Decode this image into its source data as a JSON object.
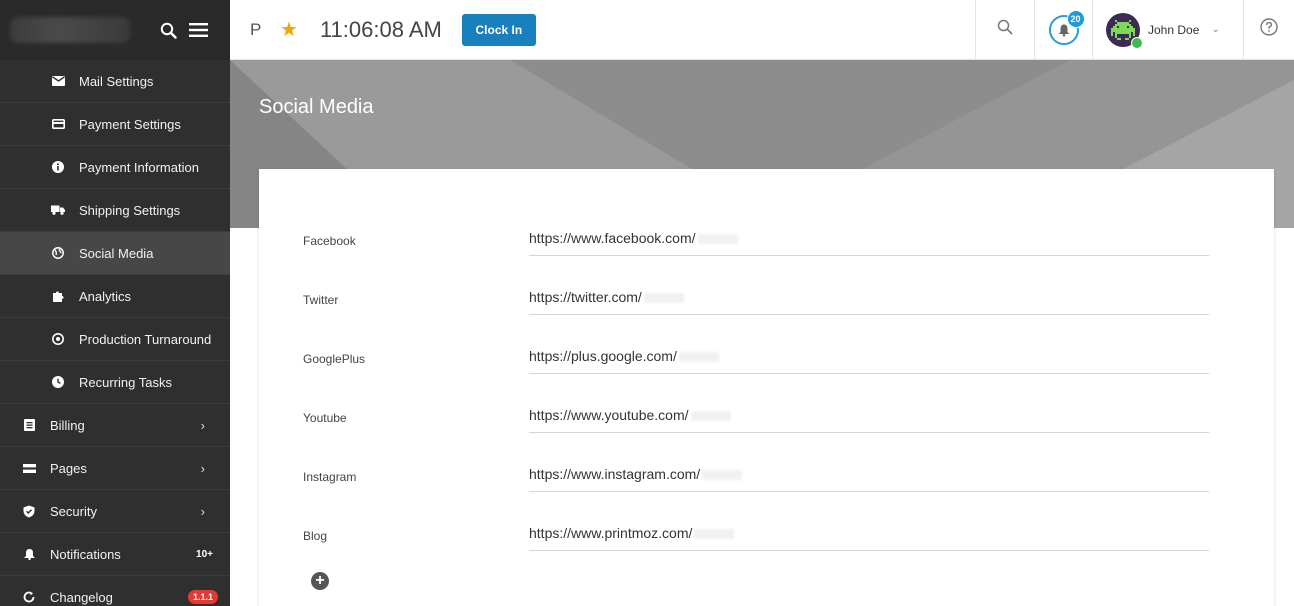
{
  "header": {
    "p_label": "P",
    "time": "11:06:08 AM",
    "clock_in_label": "Clock In",
    "notification_count": "20",
    "user_name": "John Doe"
  },
  "sidebar": {
    "sub_items": [
      {
        "label": "Mail Settings",
        "icon": "mail-icon"
      },
      {
        "label": "Payment Settings",
        "icon": "card-icon"
      },
      {
        "label": "Payment Information",
        "icon": "info-icon"
      },
      {
        "label": "Shipping Settings",
        "icon": "truck-icon"
      },
      {
        "label": "Social Media",
        "icon": "globe-icon",
        "active": true
      },
      {
        "label": "Analytics",
        "icon": "puzzle-icon"
      },
      {
        "label": "Production Turnaround",
        "icon": "clock-icon"
      },
      {
        "label": "Recurring Tasks",
        "icon": "clock-icon"
      }
    ],
    "top_items": [
      {
        "label": "Billing",
        "icon": "billing-icon"
      },
      {
        "label": "Pages",
        "icon": "pages-icon"
      },
      {
        "label": "Security",
        "icon": "shield-icon"
      },
      {
        "label": "Notifications",
        "icon": "bell-icon",
        "count": "10+"
      },
      {
        "label": "Changelog",
        "icon": "changelog-icon",
        "badge": "1.1.1"
      }
    ]
  },
  "page": {
    "title": "Social Media"
  },
  "social": [
    {
      "label": "Facebook",
      "url": "https://www.facebook.com/"
    },
    {
      "label": "Twitter",
      "url": "https://twitter.com/"
    },
    {
      "label": "GooglePlus",
      "url": "https://plus.google.com/"
    },
    {
      "label": "Youtube",
      "url": "https://www.youtube.com/"
    },
    {
      "label": "Instagram",
      "url": "https://www.instagram.com/"
    },
    {
      "label": "Blog",
      "url": "https://www.printmoz.com/"
    }
  ],
  "colors": {
    "sidebar_bg": "#2f2f2f",
    "accent": "#1a7fbd",
    "star": "#f0a500",
    "badge_red": "#e53935"
  }
}
